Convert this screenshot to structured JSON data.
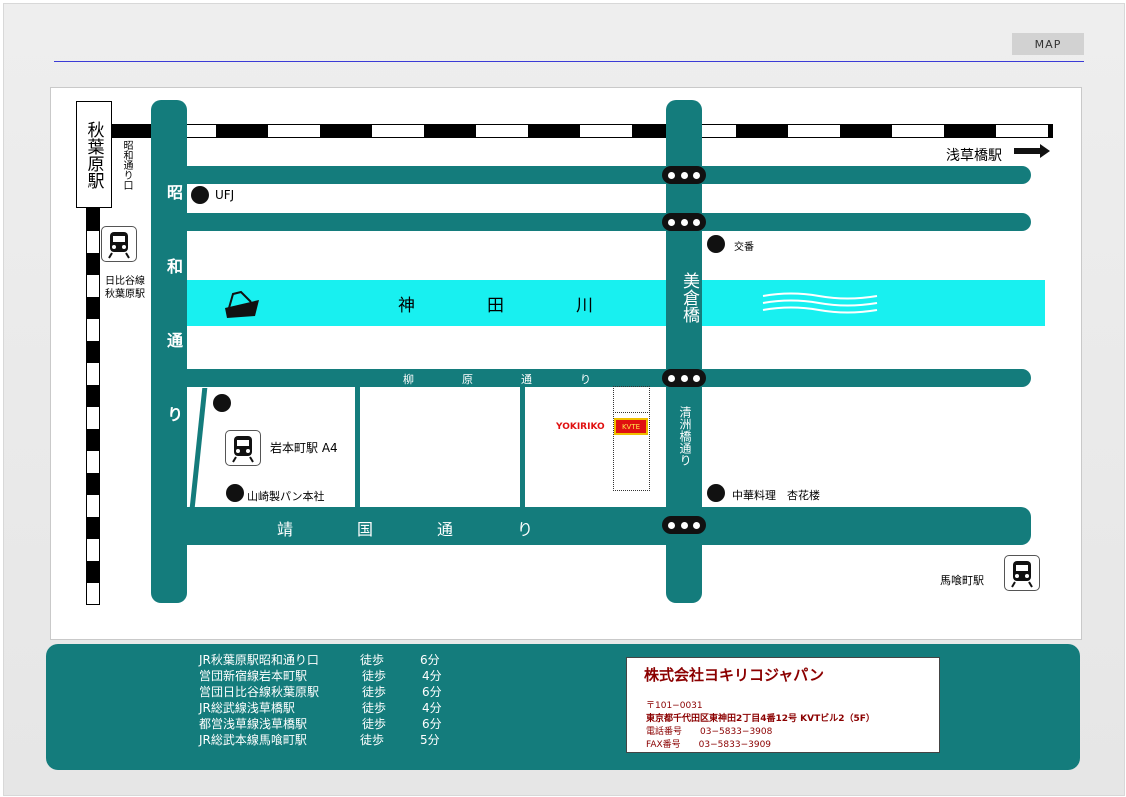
{
  "header": {
    "tab_label": "MAP"
  },
  "map": {
    "stations": {
      "akihabara": "秋葉原駅",
      "showa_exit": "昭和通り口",
      "hibiya_line": "日比谷線",
      "hibiya_station": "秋葉原駅",
      "iwamotocho": "岩本町駅 A4",
      "asakusabashi": "浅草橋駅",
      "bakurocho": "馬喰町駅"
    },
    "roads": {
      "showa": "昭和通り",
      "yanagiwara": "柳原通り",
      "yasukuni": "靖国通り",
      "kiyosubashi": "清洲橋通り",
      "mikura_bridge": "美倉橋"
    },
    "river": {
      "name": "神田川"
    },
    "landmarks": {
      "ufj": "UFJ",
      "koban": "交番",
      "yamazaki": "山崎製パン本社",
      "chinese_restaurant": "中華料理　杏花楼"
    },
    "company_marker": {
      "name": "YOKIRIKO",
      "building": "KVTE"
    }
  },
  "access": [
    {
      "line": "JR秋葉原駅昭和通り口",
      "mode": "徒歩",
      "time": "6分"
    },
    {
      "line": "営団新宿線岩本町駅",
      "mode": "徒歩",
      "time": "4分"
    },
    {
      "line": "営団日比谷線秋葉原駅",
      "mode": "徒歩",
      "time": "6分"
    },
    {
      "line": "JR総武線浅草橋駅",
      "mode": "徒歩",
      "time": "4分"
    },
    {
      "line": "都営浅草線浅草橋駅",
      "mode": "徒歩",
      "time": "6分"
    },
    {
      "line": "JR総武本線馬喰町駅",
      "mode": "徒歩",
      "time": "5分"
    }
  ],
  "company": {
    "name": "株式会社ヨキリコジャパン",
    "postal": "〒101−0031",
    "address": "東京都千代田区東神田2丁目4番12号 KVTビル2（5F）",
    "tel": "電話番号　　03−5833−3908",
    "fax": "FAX番号　　03−5833−3909"
  },
  "colors": {
    "road": "#147c7c",
    "river": "#18f0f0",
    "accent": "#8b0000",
    "marker": "#e01010"
  }
}
